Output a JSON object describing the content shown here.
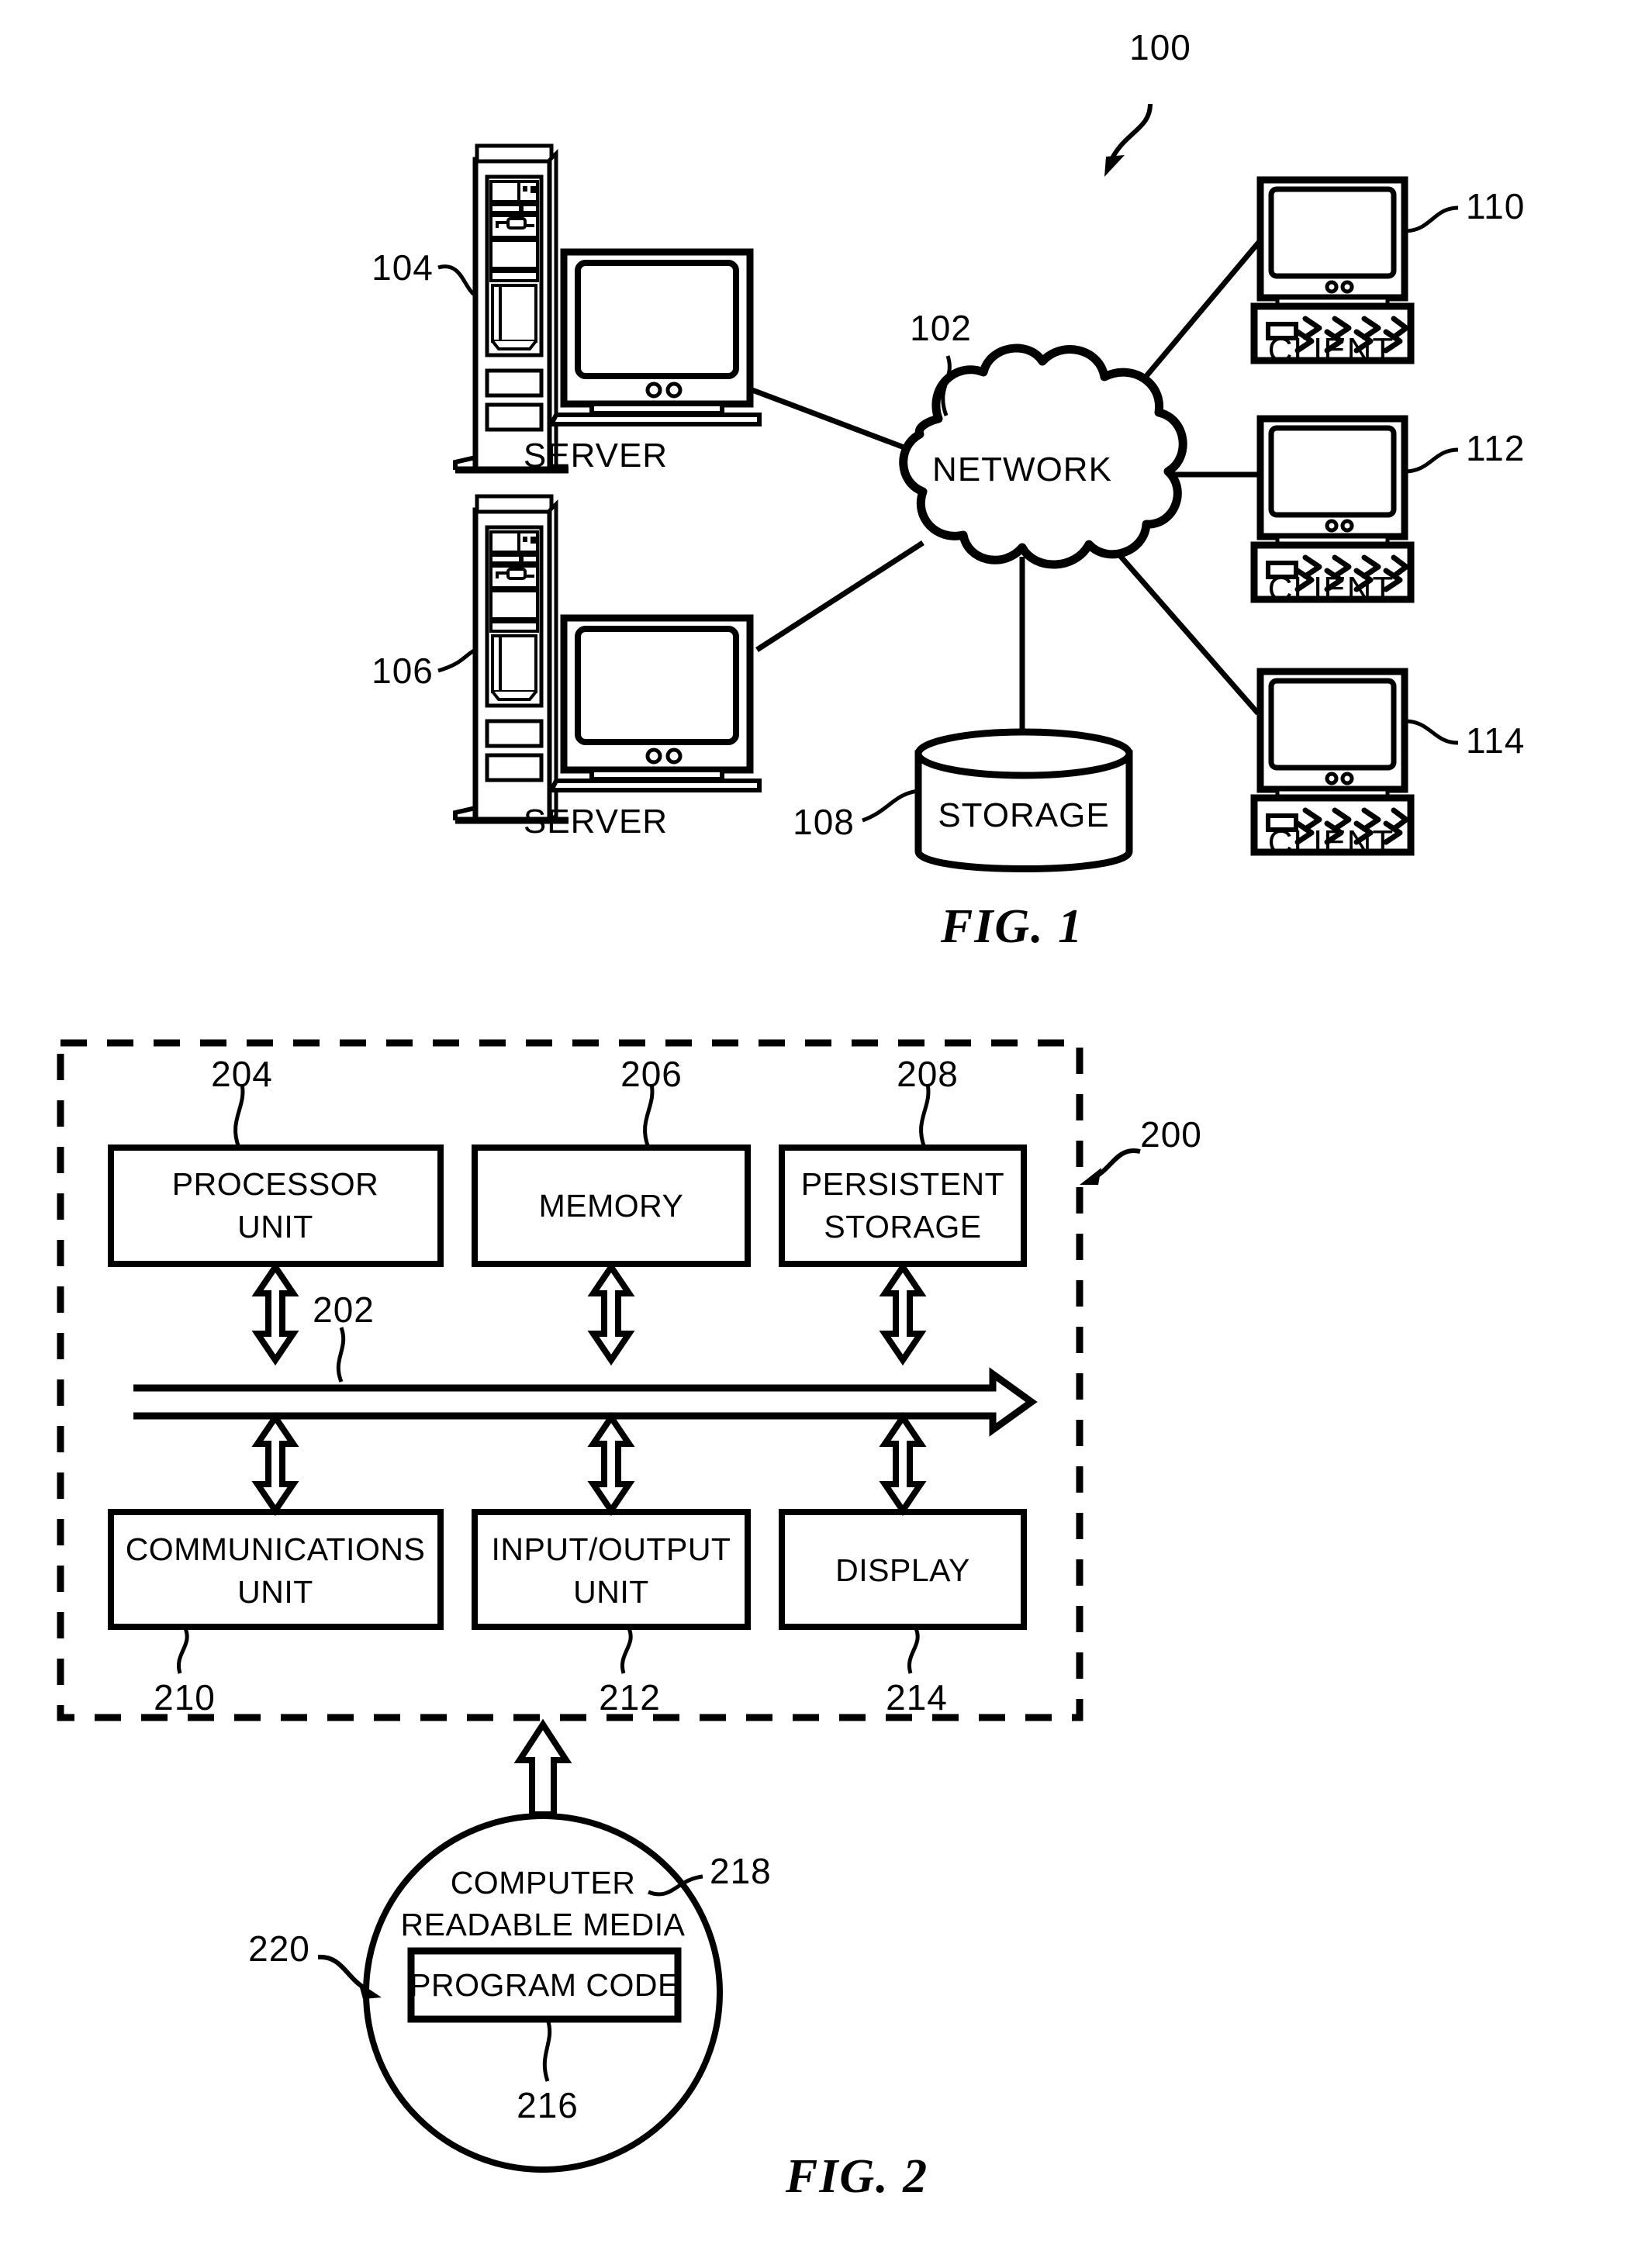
{
  "document": {
    "type": "patent-drawing-sheet",
    "figures": [
      "FIG. 1",
      "FIG. 2"
    ]
  },
  "figure1": {
    "caption": "FIG. 1",
    "system_ref": "100",
    "network": {
      "label": "NETWORK",
      "ref": "102"
    },
    "storage": {
      "label": "STORAGE",
      "ref": "108"
    },
    "servers": [
      {
        "label": "SERVER",
        "ref": "104"
      },
      {
        "label": "SERVER",
        "ref": "106"
      }
    ],
    "clients": [
      {
        "label": "CLIENT",
        "ref": "110"
      },
      {
        "label": "CLIENT",
        "ref": "112"
      },
      {
        "label": "CLIENT",
        "ref": "114"
      }
    ]
  },
  "figure2": {
    "caption": "FIG. 2",
    "data_processing_system_ref": "200",
    "bus": {
      "label": "",
      "ref": "202"
    },
    "top_row": [
      {
        "line1": "PROCESSOR",
        "line2": "UNIT",
        "ref": "204"
      },
      {
        "line1": "MEMORY",
        "line2": "",
        "ref": "206"
      },
      {
        "line1": "PERSISTENT",
        "line2": "STORAGE",
        "ref": "208"
      }
    ],
    "bottom_row": [
      {
        "line1": "COMMUNICATIONS",
        "line2": "UNIT",
        "ref": "210"
      },
      {
        "line1": "INPUT/OUTPUT",
        "line2": "UNIT",
        "ref": "212"
      },
      {
        "line1": "DISPLAY",
        "line2": "",
        "ref": "214"
      }
    ],
    "media": {
      "line1": "COMPUTER",
      "line2": "READABLE MEDIA",
      "ref": "218",
      "program_product_ref": "220",
      "program_code": {
        "label": "PROGRAM CODE",
        "ref": "216"
      }
    }
  },
  "colors": {
    "ink": "#000000",
    "paper": "#ffffff"
  }
}
